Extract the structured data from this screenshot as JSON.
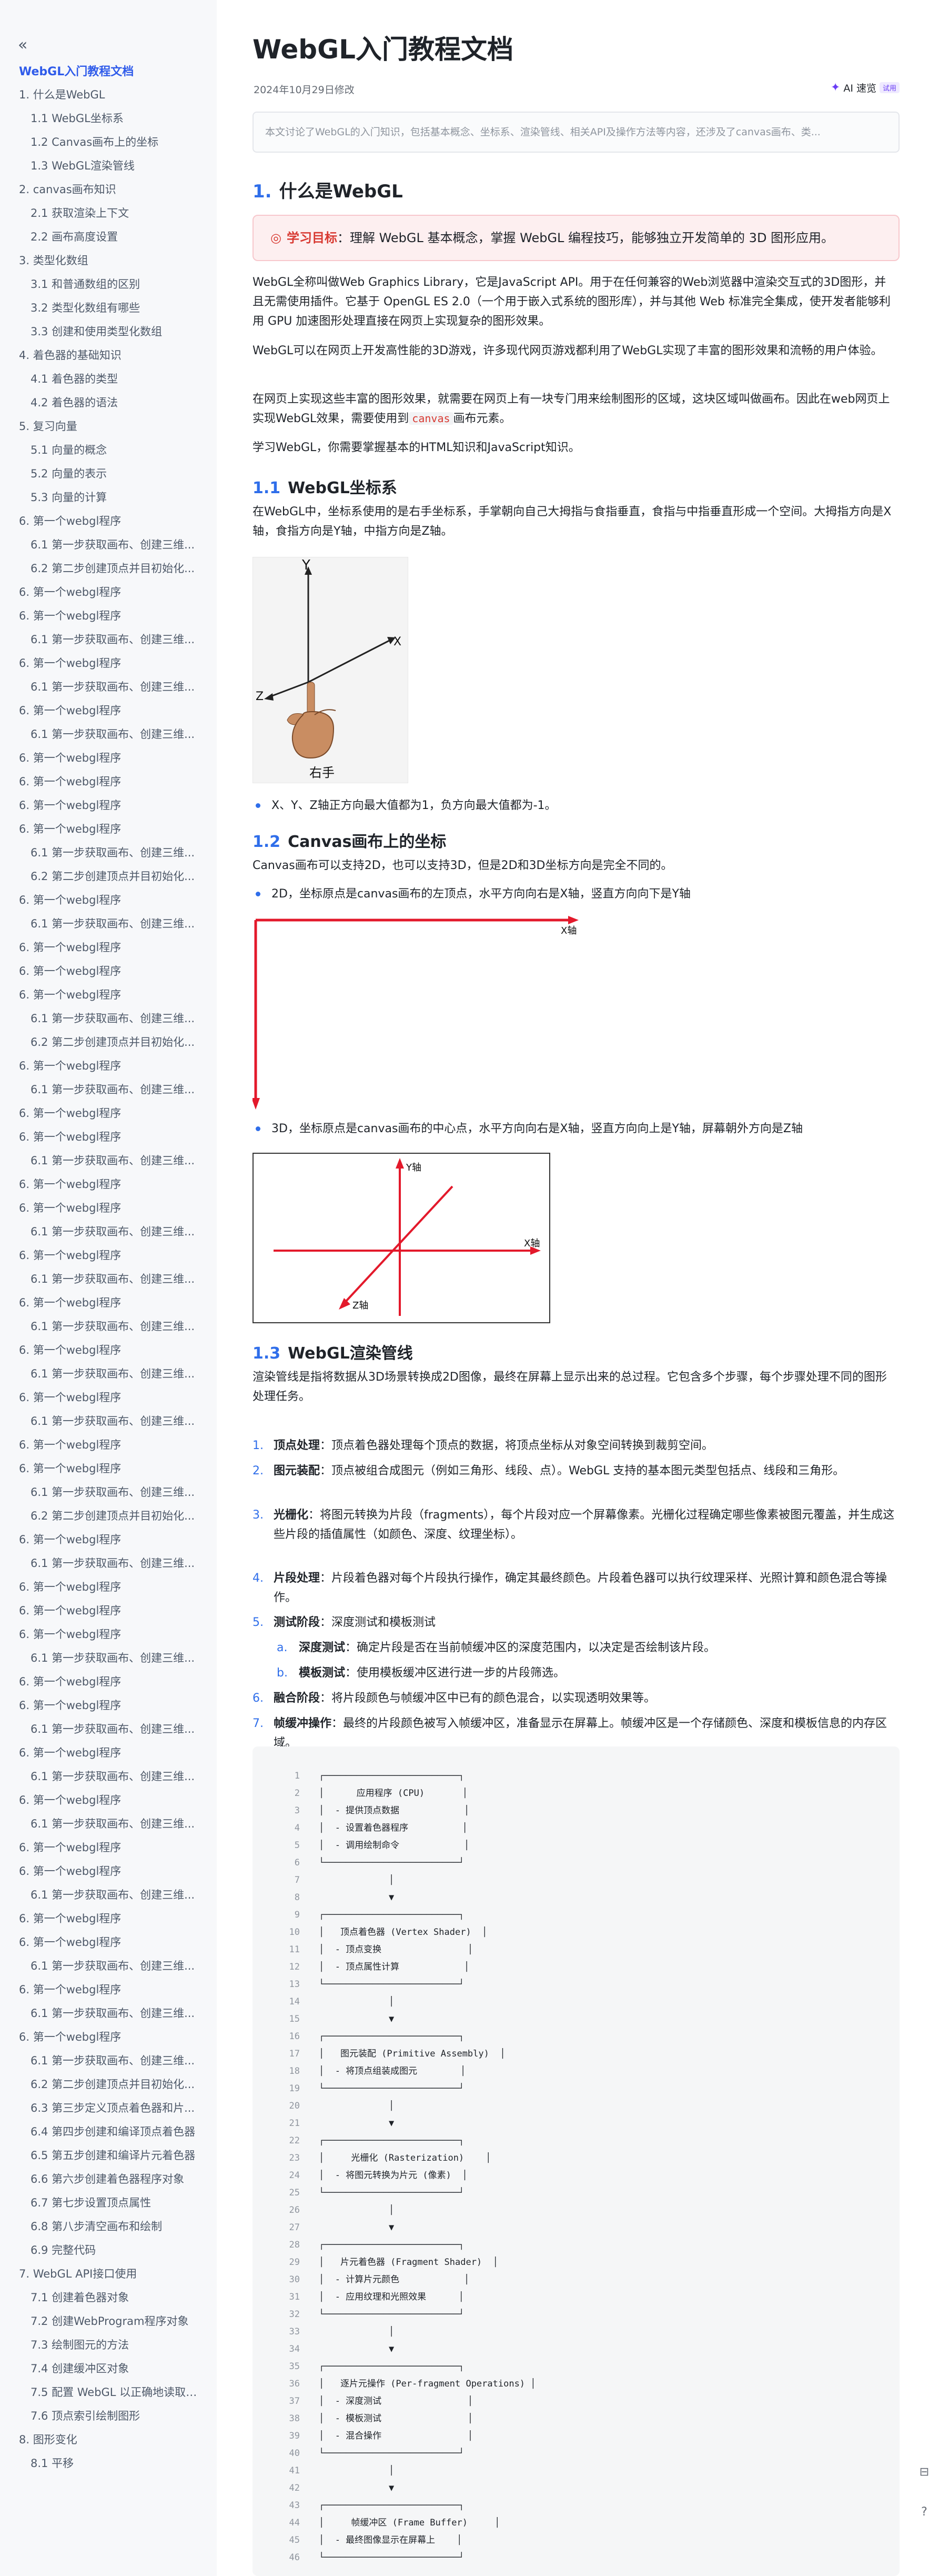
{
  "sidebar": {
    "doc_title": "WebGL入门教程文档",
    "toc": [
      {
        "label": "1. 什么是WebGL",
        "level": 1
      },
      {
        "label": "1.1 WebGL坐标系",
        "level": 2
      },
      {
        "label": "1.2 Canvas画布上的坐标",
        "level": 2
      },
      {
        "label": "1.3 WebGL渲染管线",
        "level": 2
      },
      {
        "label": "2. canvas画布知识",
        "level": 1
      },
      {
        "label": "2.1 获取渲染上下文",
        "level": 2
      },
      {
        "label": "2.2 画布高度设置",
        "level": 2
      },
      {
        "label": "3. 类型化数组",
        "level": 1
      },
      {
        "label": "3.1 和普通数组的区别",
        "level": 2
      },
      {
        "label": "3.2 类型化数组有哪些",
        "level": 2
      },
      {
        "label": "3.3 创建和使用类型化数组",
        "level": 2
      },
      {
        "label": "4. 着色器的基础知识",
        "level": 1
      },
      {
        "label": "4.1 着色器的类型",
        "level": 2
      },
      {
        "label": "4.2 着色器的语法",
        "level": 2
      },
      {
        "label": "5. 复习向量",
        "level": 1
      },
      {
        "label": "5.1 向量的概念",
        "level": 2
      },
      {
        "label": "5.2 向量的表示",
        "level": 2
      },
      {
        "label": "5.3 向量的计算",
        "level": 2
      },
      {
        "label": "6. 第一个webgl程序",
        "level": 1
      },
      {
        "label": "6.1 第一步获取画布、创建三维...",
        "level": 2
      },
      {
        "label": "6.2 第二步创建顶点并目初始化...",
        "level": 2
      },
      {
        "label": "6. 第一个webgl程序",
        "level": 1
      },
      {
        "label": "6. 第一个webgl程序",
        "level": 1
      },
      {
        "label": "6.1 第一步获取画布、创建三维...",
        "level": 2
      },
      {
        "label": "6. 第一个webgl程序",
        "level": 1
      },
      {
        "label": "6.1 第一步获取画布、创建三维...",
        "level": 2
      },
      {
        "label": "6. 第一个webgl程序",
        "level": 1
      },
      {
        "label": "6.1 第一步获取画布、创建三维...",
        "level": 2
      },
      {
        "label": "6. 第一个webgl程序",
        "level": 1
      },
      {
        "label": "6. 第一个webgl程序",
        "level": 1
      },
      {
        "label": "6. 第一个webgl程序",
        "level": 1
      },
      {
        "label": "6. 第一个webgl程序",
        "level": 1
      },
      {
        "label": "6.1 第一步获取画布、创建三维...",
        "level": 2
      },
      {
        "label": "6.2 第二步创建顶点并目初始化...",
        "level": 2
      },
      {
        "label": "6. 第一个webgl程序",
        "level": 1
      },
      {
        "label": "6.1 第一步获取画布、创建三维...",
        "level": 2
      },
      {
        "label": "6. 第一个webgl程序",
        "level": 1
      },
      {
        "label": "6. 第一个webgl程序",
        "level": 1
      },
      {
        "label": "6. 第一个webgl程序",
        "level": 1
      },
      {
        "label": "6.1 第一步获取画布、创建三维...",
        "level": 2
      },
      {
        "label": "6.2 第二步创建顶点并目初始化...",
        "level": 2
      },
      {
        "label": "6. 第一个webgl程序",
        "level": 1
      },
      {
        "label": "6.1 第一步获取画布、创建三维...",
        "level": 2
      },
      {
        "label": "6. 第一个webgl程序",
        "level": 1
      },
      {
        "label": "6. 第一个webgl程序",
        "level": 1
      },
      {
        "label": "6.1 第一步获取画布、创建三维...",
        "level": 2
      },
      {
        "label": "6. 第一个webgl程序",
        "level": 1
      },
      {
        "label": "6. 第一个webgl程序",
        "level": 1
      },
      {
        "label": "6.1 第一步获取画布、创建三维...",
        "level": 2
      },
      {
        "label": "6. 第一个webgl程序",
        "level": 1
      },
      {
        "label": "6.1 第一步获取画布、创建三维...",
        "level": 2
      },
      {
        "label": "6. 第一个webgl程序",
        "level": 1
      },
      {
        "label": "6.1 第一步获取画布、创建三维...",
        "level": 2
      },
      {
        "label": "6. 第一个webgl程序",
        "level": 1
      },
      {
        "label": "6.1 第一步获取画布、创建三维...",
        "level": 2
      },
      {
        "label": "6. 第一个webgl程序",
        "level": 1
      },
      {
        "label": "6.1 第一步获取画布、创建三维...",
        "level": 2
      },
      {
        "label": "6. 第一个webgl程序",
        "level": 1
      },
      {
        "label": "6. 第一个webgl程序",
        "level": 1
      },
      {
        "label": "6.1 第一步获取画布、创建三维...",
        "level": 2
      },
      {
        "label": "6.2 第二步创建顶点并目初始化...",
        "level": 2
      },
      {
        "label": "6. 第一个webgl程序",
        "level": 1
      },
      {
        "label": "6.1 第一步获取画布、创建三维...",
        "level": 2
      },
      {
        "label": "6. 第一个webgl程序",
        "level": 1
      },
      {
        "label": "6. 第一个webgl程序",
        "level": 1
      },
      {
        "label": "6. 第一个webgl程序",
        "level": 1
      },
      {
        "label": "6.1 第一步获取画布、创建三维...",
        "level": 2
      },
      {
        "label": "6. 第一个webgl程序",
        "level": 1
      },
      {
        "label": "6. 第一个webgl程序",
        "level": 1
      },
      {
        "label": "6.1 第一步获取画布、创建三维...",
        "level": 2
      },
      {
        "label": "6. 第一个webgl程序",
        "level": 1
      },
      {
        "label": "6.1 第一步获取画布、创建三维...",
        "level": 2
      },
      {
        "label": "6. 第一个webgl程序",
        "level": 1
      },
      {
        "label": "6.1 第一步获取画布、创建三维...",
        "level": 2
      },
      {
        "label": "6. 第一个webgl程序",
        "level": 1
      },
      {
        "label": "6. 第一个webgl程序",
        "level": 1
      },
      {
        "label": "6.1 第一步获取画布、创建三维...",
        "level": 2
      },
      {
        "label": "6. 第一个webgl程序",
        "level": 1
      },
      {
        "label": "6. 第一个webgl程序",
        "level": 1
      },
      {
        "label": "6.1 第一步获取画布、创建三维...",
        "level": 2
      },
      {
        "label": "6. 第一个webgl程序",
        "level": 1
      },
      {
        "label": "6.1 第一步获取画布、创建三维...",
        "level": 2
      },
      {
        "label": "6. 第一个webgl程序",
        "level": 1
      },
      {
        "label": "6.1 第一步获取画布、创建三维...",
        "level": 2
      },
      {
        "label": "6.2 第二步创建顶点并目初始化...",
        "level": 2
      },
      {
        "label": "6.3 第三步定义顶点着色器和片...",
        "level": 2
      },
      {
        "label": "6.4 第四步创建和编译顶点着色器",
        "level": 2
      },
      {
        "label": "6.5 第五步创建和编译片元着色器",
        "level": 2
      },
      {
        "label": "6.6 第六步创建着色器程序对象",
        "level": 2
      },
      {
        "label": "6.7 第七步设置顶点属性",
        "level": 2
      },
      {
        "label": "6.8 第八步清空画布和绘制",
        "level": 2
      },
      {
        "label": "6.9 完整代码",
        "level": 2
      },
      {
        "label": "7. WebGL API接口使用",
        "level": 1
      },
      {
        "label": "7.1 创建着色器对象",
        "level": 2
      },
      {
        "label": "7.2 创建WebProgram程序对象",
        "level": 2
      },
      {
        "label": "7.3 绘制图元的方法",
        "level": 2
      },
      {
        "label": "7.4 创建缓冲区对象",
        "level": 2
      },
      {
        "label": "7.5 配置 WebGL 以正确地读取和...",
        "level": 2
      },
      {
        "label": "7.6 顶点索引绘制图形",
        "level": 2
      },
      {
        "label": "8. 图形变化",
        "level": 1
      },
      {
        "label": "8.1 平移",
        "level": 2
      }
    ]
  },
  "doc": {
    "title": "WebGL入门教程文档",
    "date": "2024年10月29日修改",
    "ai_label": "AI 速览",
    "ai_badge": "试用",
    "summary": "本文讨论了WebGL的入门知识，包括基本概念、坐标系、渲染管线、相关API及操作方法等内容，还涉及了canvas画布、类..."
  },
  "sec1": {
    "num": "1.",
    "title": "什么是WebGL",
    "callout_label": "学习目标",
    "callout_text": "：理解 WebGL 基本概念，掌握 WebGL 编程技巧，能够独立开发简单的 3D 图形应用。",
    "p1": "WebGL全称叫做Web Graphics Library，它是JavaScript API。用于在任何兼容的Web浏览器中渲染交互式的3D图形，并且无需使用插件。它基于 OpenGL ES 2.0（一个用于嵌入式系统的图形库），并与其他 Web 标准完全集成，使开发者能够利用 GPU 加速图形处理直接在网页上实现复杂的图形效果。",
    "p2": "WebGL可以在网页上开发高性能的3D游戏，许多现代网页游戏都利用了WebGL实现了丰富的图形效果和流畅的用户体验。",
    "p3a": "在网页上实现这些丰富的图形效果，就需要在网页上有一块专门用来绘制图形的区域，这块区域叫做画布。因此在web网页上实现WebGL效果，需要使用到",
    "p3code": "canvas",
    "p3b": "画布元素。",
    "p4": "学习WebGL，你需要掌握基本的HTML知识和JavaScript知识。"
  },
  "sec11": {
    "num": "1.1",
    "title": "WebGL坐标系",
    "p1": "在WebGL中，坐标系使用的是右手坐标系，手掌朝向自己大拇指与食指垂直，食指与中指垂直形成一个空间。大拇指方向是X轴，食指方向是Y轴，中指方向是Z轴。",
    "fig_y": "Y",
    "fig_x": "X",
    "fig_z": "Z",
    "fig_caption": "右手",
    "bullet1": "X、Y、Z轴正方向最大值都为1，负方向最大值都为-1。"
  },
  "sec12": {
    "num": "1.2",
    "title": "Canvas画布上的坐标",
    "p1": "Canvas画布可以支持2D，也可以支持3D，但是2D和3D坐标方向是完全不同的。",
    "bullet1": "2D，坐标原点是canvas画布的左顶点，水平方向向右是X轴，竖直方向向下是Y轴",
    "fig1_x": "X轴",
    "bullet2": "3D，坐标原点是canvas画布的中心点，水平方向向右是X轴，竖直方向向上是Y轴，屏幕朝外方向是Z轴",
    "fig2_y": "Y轴",
    "fig2_x": "X轴",
    "fig2_z": "Z轴"
  },
  "sec13": {
    "num": "1.3",
    "title": "WebGL渲染管线",
    "p1": "渲染管线是指将数据从3D场景转换成2D图像，最终在屏幕上显示出来的总过程。它包含多个步骤，每个步骤处理不同的图形处理任务。",
    "steps": [
      {
        "n": "1.",
        "b": "顶点处理",
        "t": "：顶点着色器处理每个顶点的数据，将顶点坐标从对象空间转换到裁剪空间。"
      },
      {
        "n": "2.",
        "b": "图元装配",
        "t": "：顶点被组合成图元（例如三角形、线段、点）。WebGL 支持的基本图元类型包括点、线段和三角形。"
      },
      {
        "n": "3.",
        "b": "光栅化",
        "t": "：将图元转换为片段（fragments），每个片段对应一个屏幕像素。光栅化过程确定哪些像素被图元覆盖，并生成这些片段的插值属性（如颜色、深度、纹理坐标）。"
      },
      {
        "n": "4.",
        "b": "片段处理",
        "t": "：片段着色器对每个片段执行操作，确定其最终颜色。片段着色器可以执行纹理采样、光照计算和颜色混合等操作。"
      },
      {
        "n": "5.",
        "b": "测试阶段",
        "t": "：深度测试和模板测试"
      },
      {
        "n": "a.",
        "b": "深度测试",
        "t": "：确定片段是否在当前帧缓冲区的深度范围内，以决定是否绘制该片段。"
      },
      {
        "n": "b.",
        "b": "模板测试",
        "t": "：使用模板缓冲区进行进一步的片段筛选。"
      },
      {
        "n": "6.",
        "b": "融合阶段",
        "t": "：将片段颜色与帧缓冲区中已有的颜色混合，以实现透明效果等。"
      },
      {
        "n": "7.",
        "b": "帧缓冲操作",
        "t": "：最终的片段颜色被写入帧缓冲区，准备显示在屏幕上。帧缓冲区是一个存储颜色、深度和模板信息的内存区域。"
      }
    ]
  },
  "code": {
    "lines": [
      "┌─────────────────────────┐",
      "│      应用程序 (CPU)       │",
      "│  - 提供顶点数据            │",
      "│  - 设置着色器程序          │",
      "│  - 调用绘制命令            │",
      "└─────────────────────────┘",
      "             │",
      "             ▼",
      "┌─────────────────────────┐",
      "│   顶点着色器 (Vertex Shader)  │",
      "│  - 顶点变换                │",
      "│  - 顶点属性计算            │",
      "└─────────────────────────┘",
      "             │",
      "             ▼",
      "┌─────────────────────────┐",
      "│   图元装配 (Primitive Assembly)  │",
      "│  - 将顶点组装成图元        │",
      "└─────────────────────────┘",
      "             │",
      "             ▼",
      "┌─────────────────────────┐",
      "│     光栅化 (Rasterization)    │",
      "│  - 将图元转换为片元 (像素)  │",
      "└─────────────────────────┘",
      "             │",
      "             ▼",
      "┌─────────────────────────┐",
      "│   片元着色器 (Fragment Shader)  │",
      "│  - 计算片元颜色            │",
      "│  - 应用纹理和光照效果      │",
      "└─────────────────────────┘",
      "             │",
      "             ▼",
      "┌─────────────────────────┐",
      "│   逐片元操作 (Per-fragment Operations) │",
      "│  - 深度测试                │",
      "│  - 模板测试                │",
      "│  - 混合操作                │",
      "└─────────────────────────┘",
      "             │",
      "             ▼",
      "┌─────────────────────────┐",
      "│     帧缓冲区 (Frame Buffer)     │",
      "│  - 最终图像显示在屏幕上    │",
      "└─────────────────────────┘"
    ]
  },
  "colors": {
    "accent": "#2f6eea",
    "axis_red": "#e3192b",
    "callout_bg": "#fdeff0"
  },
  "icons": {
    "collapse": "chevrons-left-icon",
    "ai": "sparkle-icon",
    "callout": "target-icon"
  }
}
